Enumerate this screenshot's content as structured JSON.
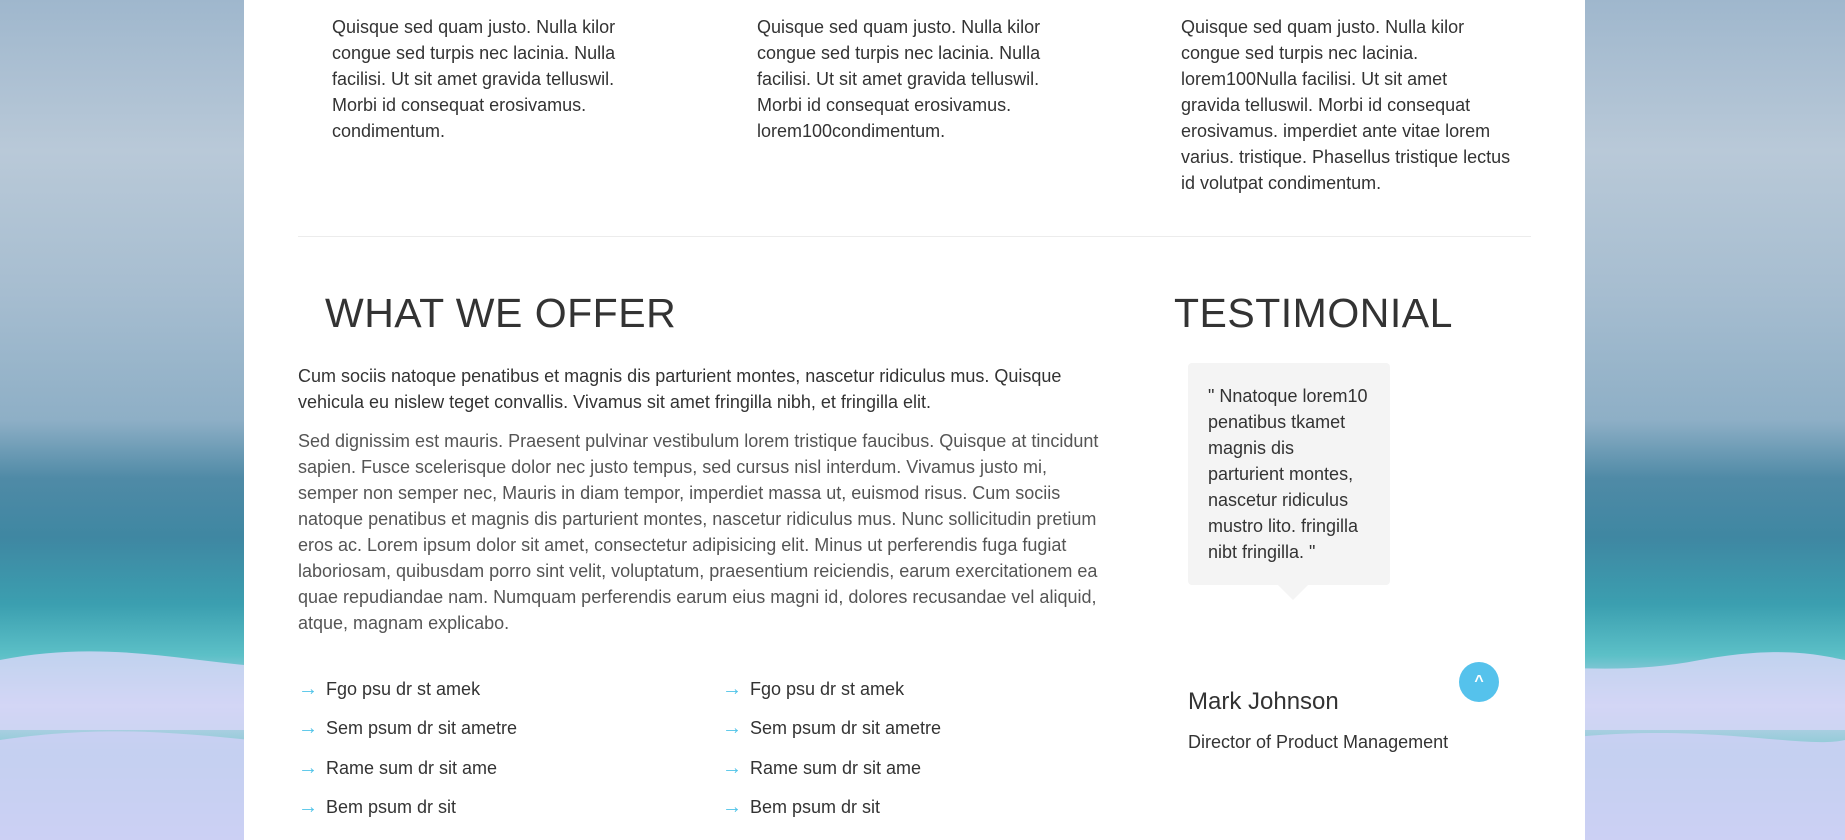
{
  "features": [
    {
      "text": "Quisque sed quam justo. Nulla kilor congue sed turpis nec lacinia. Nulla facilisi. Ut sit amet gravida telluswil. Morbi id consequat erosivamus. condimentum."
    },
    {
      "text": "Quisque sed quam justo. Nulla kilor congue sed turpis nec lacinia. Nulla facilisi. Ut sit amet gravida telluswil. Morbi id consequat erosivamus. lorem100condimentum."
    },
    {
      "text": "Quisque sed quam justo. Nulla kilor congue sed turpis nec lacinia. lorem100Nulla facilisi. Ut sit amet gravida telluswil. Morbi id consequat erosivamus. imperdiet ante vitae lorem varius. tristique. Phasellus tristique lectus id volutpat condimentum."
    }
  ],
  "offer": {
    "title": "WHAT WE OFFER",
    "lead": "Cum sociis natoque penatibus et magnis dis parturient montes, nascetur ridiculus mus. Quisque vehicula eu nislew teget convallis. Vivamus sit amet fringilla nibh, et fringilla elit.",
    "body": "Sed dignissim est mauris. Praesent pulvinar vestibulum lorem tristique faucibus. Quisque at tincidunt sapien. Fusce scelerisque dolor nec justo tempus, sed cursus nisl interdum. Vivamus justo mi, semper non semper nec, Mauris in diam tempor, imperdiet massa ut, euismod risus. Cum sociis natoque penatibus et magnis dis parturient montes, nascetur ridiculus mus. Nunc sollicitudin pretium eros ac. Lorem ipsum dolor sit amet, consectetur adipisicing elit. Minus ut perferendis fuga fugiat laboriosam, quibusdam porro sint velit, voluptatum, praesentium reiciendis, earum exercitationem ea quae repudiandae nam. Numquam perferendis earum eius magni id, dolores recusandae vel aliquid, atque, magnam explicabo.",
    "arrow": "→",
    "list_left": [
      "Fgo psu dr st amek",
      "Sem psum dr sit ametre",
      "Rame sum dr sit ame",
      "Bem psum dr sit"
    ],
    "list_right": [
      "Fgo psu dr st amek",
      "Sem psum dr sit ametre",
      "Rame sum dr sit ame",
      "Bem psum dr sit"
    ]
  },
  "testimonial": {
    "title": "TESTIMONIAL",
    "quote": "\" Nnatoque lorem10 penatibus tkamet magnis dis parturient montes, nascetur ridiculus mustro lito. fringilla nibt fringilla. \"",
    "name": "Mark Johnson",
    "role": "Director of Product Management"
  },
  "back_to_top": {
    "label": "^"
  },
  "colors": {
    "accent": "#55c2ec",
    "arrow": "#4fc3e8",
    "bubble_bg": "#f4f4f4"
  }
}
